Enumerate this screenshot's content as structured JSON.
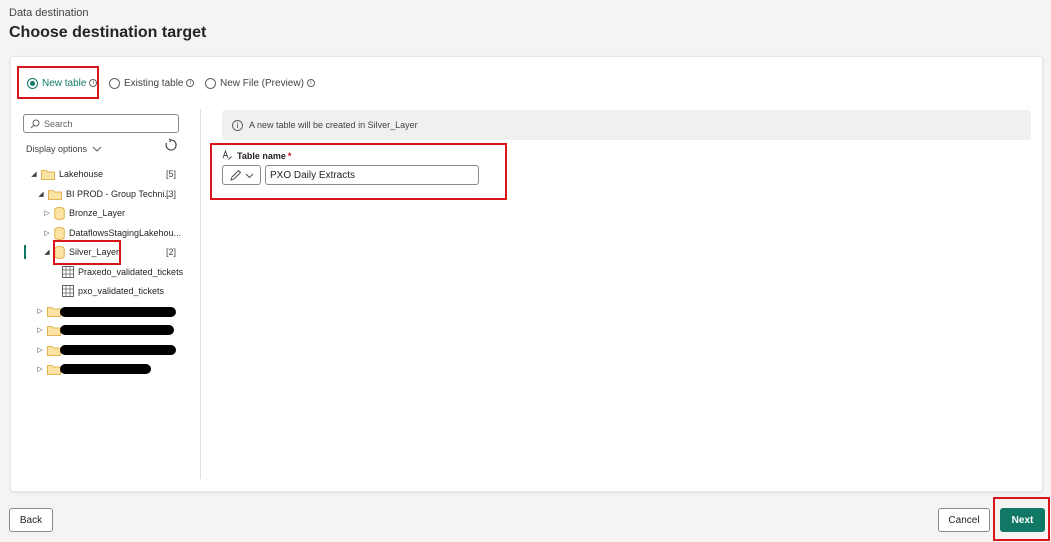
{
  "header": {
    "subtitle": "Data destination",
    "title": "Choose destination target"
  },
  "options": {
    "new_table": "New table",
    "existing_table": "Existing table",
    "new_file": "New File (Preview)",
    "selected": "new_table"
  },
  "navigator": {
    "search_placeholder": "Search",
    "display_options": "Display options",
    "tree": {
      "lakehouse": {
        "label": "Lakehouse",
        "count": "[5]"
      },
      "workspace": {
        "label": "BI PROD - Group Techni...",
        "count": "[3]"
      },
      "bronze": {
        "label": "Bronze_Layer"
      },
      "staging": {
        "label": "DataflowsStagingLakehou..."
      },
      "silver": {
        "label": "Silver_Layer",
        "count": "[2]"
      },
      "table1": {
        "label": "Praxedo_validated_tickets"
      },
      "table2": {
        "label": "pxo_validated_tickets"
      }
    }
  },
  "details": {
    "info_banner": "A new table will be created in Silver_Layer",
    "table_name_label": "Table name",
    "required_mark": "*",
    "table_name_value": "PXO Daily Extracts"
  },
  "footer": {
    "back": "Back",
    "cancel": "Cancel",
    "next": "Next"
  },
  "colors": {
    "accent": "#117865",
    "highlight": "#d9141b"
  }
}
